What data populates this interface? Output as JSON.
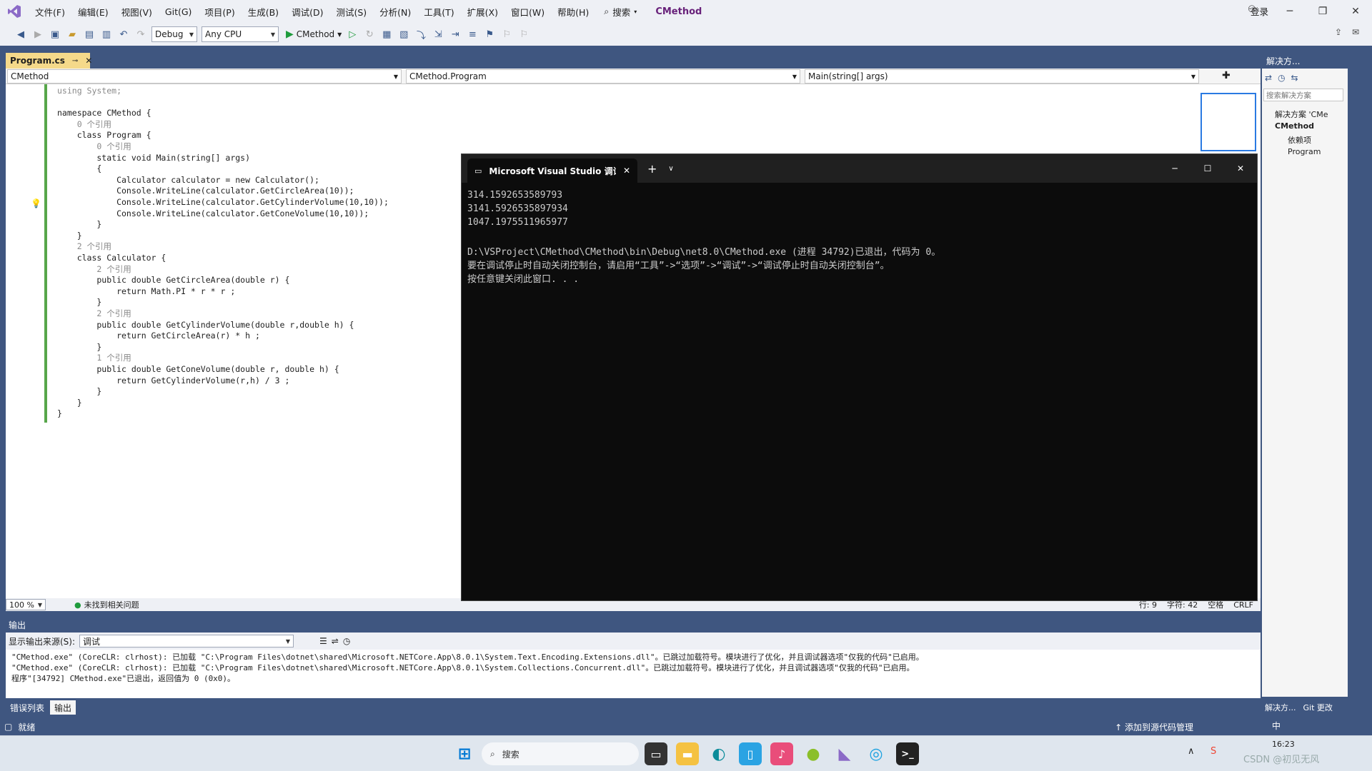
{
  "menubar": {
    "items": [
      "文件(F)",
      "编辑(E)",
      "视图(V)",
      "Git(G)",
      "项目(P)",
      "生成(B)",
      "调试(D)",
      "测试(S)",
      "分析(N)",
      "工具(T)",
      "扩展(X)",
      "窗口(W)",
      "帮助(H)"
    ],
    "search_label": "搜索",
    "solution_title": "CMethod",
    "signin_label": "登录"
  },
  "toolbar": {
    "config": "Debug",
    "platform": "Any CPU",
    "run_target": "CMethod"
  },
  "editor": {
    "tab_label": "Program.cs",
    "nav_project": "CMethod",
    "nav_class": "CMethod.Program",
    "nav_member": "Main(string[] args)",
    "zoom": "100 %",
    "issues": "未找到相关问题",
    "line": "行: 9",
    "col": "字符: 42",
    "spaces": "空格",
    "eol": "CRLF",
    "code_lines": [
      "using System;",
      "",
      "namespace CMethod {",
      "    0 个引用",
      "    class Program {",
      "        0 个引用",
      "        static void Main(string[] args)",
      "        {",
      "            Calculator calculator = new Calculator();",
      "            Console.WriteLine(calculator.GetCircleArea(10));",
      "            Console.WriteLine(calculator.GetCylinderVolume(10,10));",
      "            Console.WriteLine(calculator.GetConeVolume(10,10));",
      "        }",
      "    }",
      "    2 个引用",
      "    class Calculator {",
      "        2 个引用",
      "        public double GetCircleArea(double r) {",
      "            return Math.PI * r * r ;",
      "        }",
      "        2 个引用",
      "        public double GetCylinderVolume(double r,double h) {",
      "            return GetCircleArea(r) * h ;",
      "        }",
      "        1 个引用",
      "        public double GetConeVolume(double r, double h) {",
      "            return GetCylinderVolume(r,h) / 3 ;",
      "        }",
      "    }",
      "}"
    ]
  },
  "console": {
    "tab_title": "Microsoft Visual Studio 调试控",
    "lines": [
      "314.1592653589793",
      "3141.5926535897934",
      "1047.1975511965977",
      "",
      "D:\\VSProject\\CMethod\\CMethod\\bin\\Debug\\net8.0\\CMethod.exe (进程 34792)已退出，代码为 0。",
      "要在调试停止时自动关闭控制台，请启用“工具”->“选项”->“调试”->“调试停止时自动关闭控制台”。",
      "按任意键关闭此窗口. . ."
    ]
  },
  "solution_explorer": {
    "header": "解决方...",
    "search_placeholder": "搜索解决方案",
    "items": [
      "解决方案 'CMe",
      "CMethod",
      "依赖项",
      "Program"
    ],
    "tab_solution": "解决方...",
    "tab_git": "Git 更改"
  },
  "output": {
    "title": "输出",
    "source_label": "显示输出来源(S):",
    "source_value": "调试",
    "lines": [
      "\"CMethod.exe\" (CoreCLR: clrhost): 已加载 \"C:\\Program Files\\dotnet\\shared\\Microsoft.NETCore.App\\8.0.1\\System.Text.Encoding.Extensions.dll\"。已跳过加载符号。模块进行了优化，并且调试器选项\"仅我的代码\"已启用。",
      "\"CMethod.exe\" (CoreCLR: clrhost): 已加载 \"C:\\Program Files\\dotnet\\shared\\Microsoft.NETCore.App\\8.0.1\\System.Collections.Concurrent.dll\"。已跳过加载符号。模块进行了优化，并且调试器选项\"仅我的代码\"已启用。",
      "程序\"[34792] CMethod.exe\"已退出，返回值为 0 (0x0)。"
    ],
    "tabs": [
      "错误列表",
      "输出"
    ]
  },
  "statusbar": {
    "ready": "就绪",
    "add_source": "添加到源代码管理"
  },
  "taskbar": {
    "search": "搜索",
    "ime": "中",
    "time": "16:23",
    "watermark": "CSDN @初见无风"
  }
}
